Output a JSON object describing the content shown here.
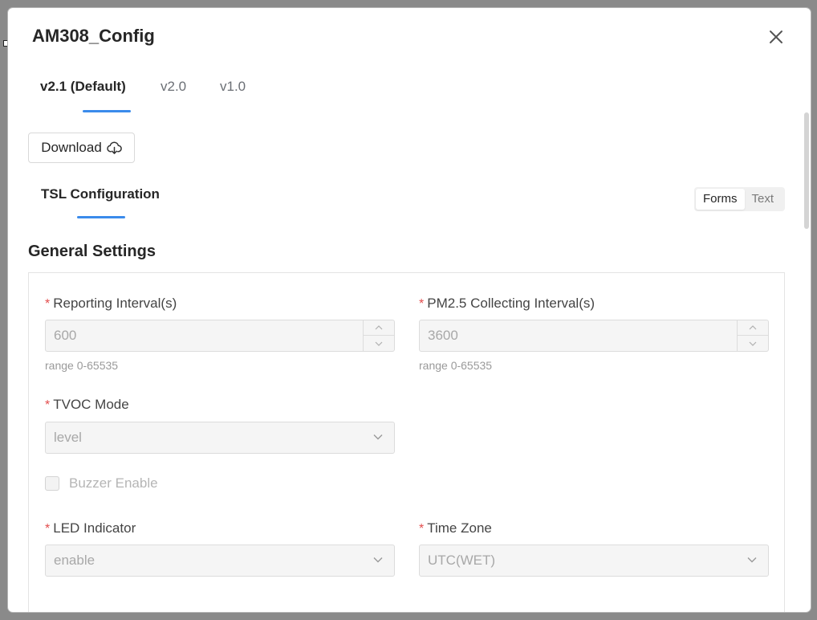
{
  "dialog": {
    "title": "AM308_Config",
    "version_tabs": [
      {
        "label": "v2.1 (Default)",
        "active": true
      },
      {
        "label": "v2.0",
        "active": false
      },
      {
        "label": "v1.0",
        "active": false
      }
    ],
    "download_label": "Download",
    "config_tab": "TSL Configuration",
    "view_toggle": {
      "options": [
        "Forms",
        "Text"
      ],
      "selected": "Forms"
    }
  },
  "section": {
    "title": "General Settings",
    "fields": {
      "reporting_interval": {
        "label": "Reporting Interval(s)",
        "value": "600",
        "help": "range 0-65535",
        "required": true
      },
      "pm25_interval": {
        "label": "PM2.5 Collecting Interval(s)",
        "value": "3600",
        "help": "range 0-65535",
        "required": true
      },
      "tvoc_mode": {
        "label": "TVOC Mode",
        "value": "level",
        "required": true
      },
      "buzzer_enable": {
        "label": "Buzzer Enable",
        "checked": false
      },
      "led_indicator": {
        "label": "LED Indicator",
        "value": "enable",
        "required": true
      },
      "time_zone": {
        "label": "Time Zone",
        "value": "UTC(WET)",
        "required": true
      }
    }
  },
  "icons": {
    "close": "close-icon",
    "download": "cloud-download-icon",
    "select_arrow": "chevron-down-icon",
    "stepper_up": "chevron-up-icon",
    "stepper_down": "chevron-down-icon"
  },
  "colors": {
    "accent": "#3b8beb",
    "required": "#e34d4d",
    "disabled_bg": "#f5f5f5",
    "disabled_text": "#a8a8a8"
  }
}
